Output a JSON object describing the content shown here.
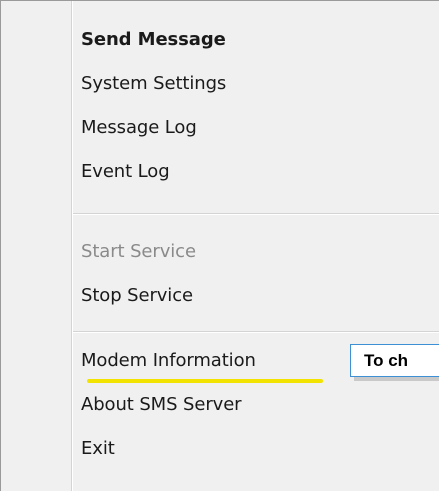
{
  "menu": {
    "items": [
      {
        "label": "Send Message"
      },
      {
        "label": "System Settings"
      },
      {
        "label": "Message Log"
      },
      {
        "label": "Event Log"
      },
      {
        "label": "Start Service"
      },
      {
        "label": "Stop Service"
      },
      {
        "label": "Modem Information"
      },
      {
        "label": "About SMS Server"
      },
      {
        "label": "Exit"
      }
    ]
  },
  "callout": {
    "text": "To ch"
  },
  "colors": {
    "menu_background": "#f0f0f0",
    "disabled_text": "#8a8a8a",
    "highlight_underline": "#f2e400",
    "callout_border": "#3d8fd6"
  }
}
